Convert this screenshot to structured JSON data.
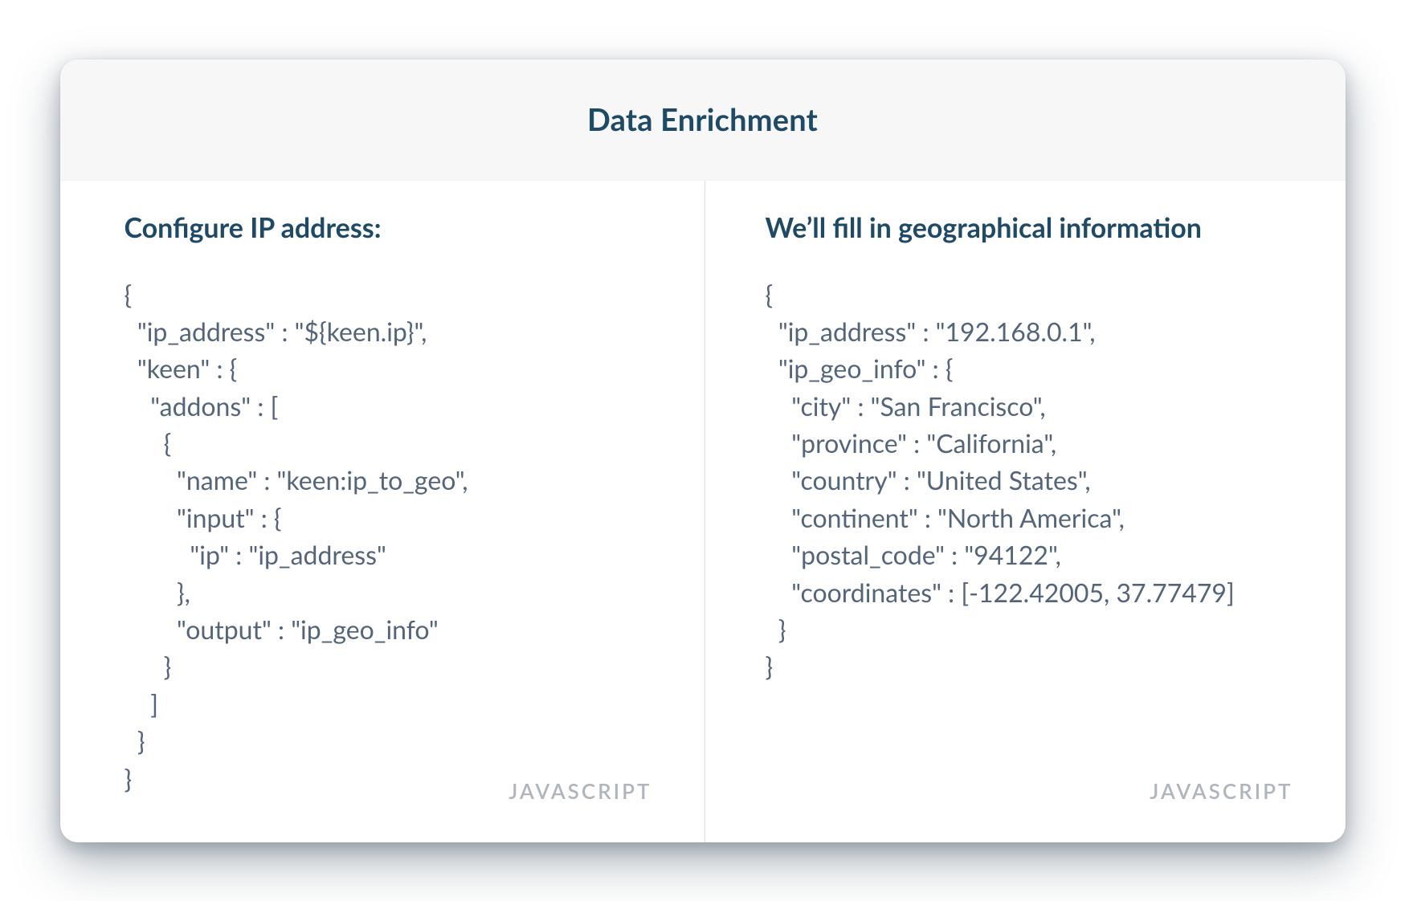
{
  "header": {
    "title": "Data Enrichment"
  },
  "left": {
    "title": "Configure IP address:",
    "code": "{\n  \"ip_address\" : \"${keen.ip}\",\n  \"keen\" : {\n    \"addons\" : [\n      {\n        \"name\" : \"keen:ip_to_geo\",\n        \"input\" : {\n          \"ip\" : \"ip_address\"\n        },\n        \"output\" : \"ip_geo_info\"\n      }\n    ]\n  }\n}",
    "language": "JAVASCRIPT"
  },
  "right": {
    "title": "We’ll fill in geographical information",
    "code": "{\n  \"ip_address\" : \"192.168.0.1\",\n  \"ip_geo_info\" : {\n    \"city\" : \"San Francisco\",\n    \"province\" : \"California\",\n    \"country\" : \"United States\",\n    \"continent\" : \"North America\",\n    \"postal_code\" : \"94122\",\n    \"coordinates\" : [-122.42005, 37.77479]\n  }\n}",
    "language": "JAVASCRIPT"
  }
}
